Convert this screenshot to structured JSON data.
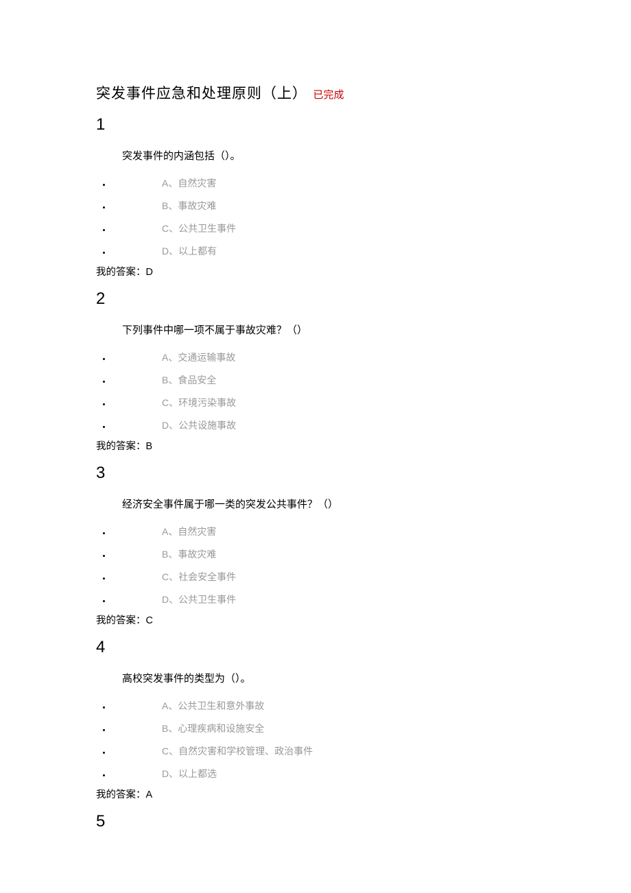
{
  "title": "突发事件应急和处理原则（上）",
  "status": "已完成",
  "myAnswerLabel": "我的答案：",
  "questions": [
    {
      "num": "1",
      "stem": "突发事件的内涵包括（）。",
      "options": [
        "A、自然灾害",
        "B、事故灾难",
        "C、公共卫生事件",
        "D、以上都有"
      ],
      "answer": "D"
    },
    {
      "num": "2",
      "stem": "下列事件中哪一项不属于事故灾难？（）",
      "options": [
        "A、交通运输事故",
        "B、食品安全",
        "C、环境污染事故",
        "D、公共设施事故"
      ],
      "answer": "B"
    },
    {
      "num": "3",
      "stem": "经济安全事件属于哪一类的突发公共事件？（）",
      "options": [
        "A、自然灾害",
        "B、事故灾难",
        "C、社会安全事件",
        "D、公共卫生事件"
      ],
      "answer": "C"
    },
    {
      "num": "4",
      "stem": "高校突发事件的类型为（）。",
      "options": [
        "A、公共卫生和意外事故",
        "B、心理疾病和设施安全",
        "C、自然灾害和学校管理、政治事件",
        "D、以上都选"
      ],
      "answer": "A"
    },
    {
      "num": "5",
      "stem": "",
      "options": [],
      "answer": ""
    }
  ]
}
